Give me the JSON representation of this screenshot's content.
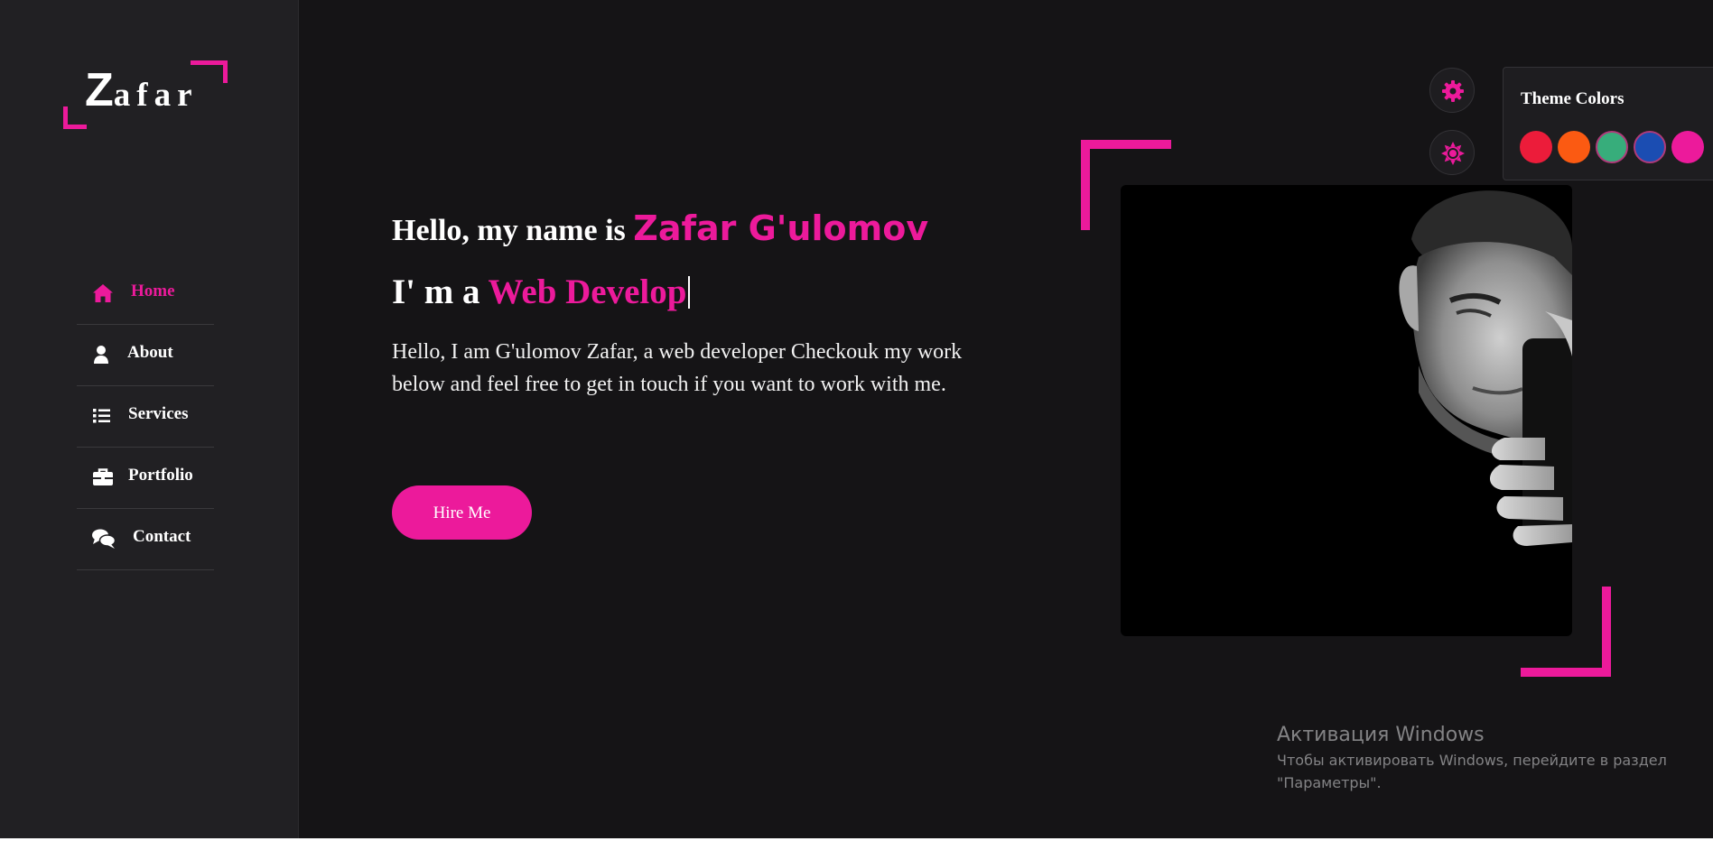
{
  "logo": {
    "first_letter": "Z",
    "rest": "afar"
  },
  "nav": {
    "items": [
      {
        "label": "Home",
        "icon": "home-icon",
        "active": true
      },
      {
        "label": "About",
        "icon": "user-icon",
        "active": false
      },
      {
        "label": "Services",
        "icon": "list-icon",
        "active": false
      },
      {
        "label": "Portfolio",
        "icon": "briefcase-icon",
        "active": false
      },
      {
        "label": "Contact",
        "icon": "chat-icon",
        "active": false
      }
    ]
  },
  "hero": {
    "greeting_prefix": "Hello, my name is ",
    "name": "Zafar G'ulomov",
    "role_prefix": "I' m a ",
    "role_typing": "Web Develop",
    "description": "Hello, I am G'ulomov Zafar, a web developer Checkouk my work below and feel free to get in touch if you want to work with me.",
    "cta_label": "Hire Me"
  },
  "theme_panel": {
    "title": "Theme Colors",
    "swatches": [
      "#ec1c3a",
      "#fb5a12",
      "#37ad7b",
      "#1b4db2",
      "#ec1a9b"
    ]
  },
  "colors": {
    "accent": "#ec1a9b",
    "background": "#151416",
    "sidebar": "#212023"
  },
  "windows_activation": {
    "title": "Активация Windows",
    "line1": "Чтобы активировать Windows, перейдите в раздел",
    "line2": "\"Параметры\"."
  }
}
